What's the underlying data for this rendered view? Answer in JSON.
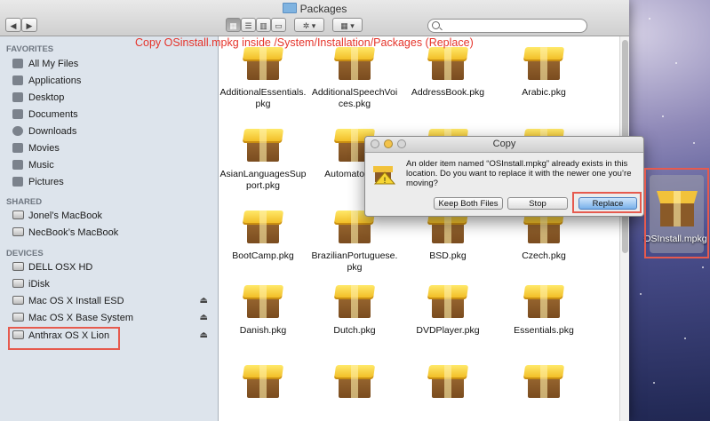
{
  "window": {
    "title": "Packages",
    "view_buttons": [
      "icon-view",
      "list-view",
      "column-view",
      "coverflow-view"
    ],
    "search_placeholder": ""
  },
  "annotation": "Copy OSinstall.mpkg inside /System/Installation/Packages (Replace)",
  "sidebar": {
    "favorites_header": "FAVORITES",
    "favorites": [
      {
        "label": "All My Files",
        "icon": "all-files-icon"
      },
      {
        "label": "Applications",
        "icon": "applications-icon"
      },
      {
        "label": "Desktop",
        "icon": "desktop-icon"
      },
      {
        "label": "Documents",
        "icon": "documents-icon"
      },
      {
        "label": "Downloads",
        "icon": "downloads-icon"
      },
      {
        "label": "Movies",
        "icon": "movies-icon"
      },
      {
        "label": "Music",
        "icon": "music-icon"
      },
      {
        "label": "Pictures",
        "icon": "pictures-icon"
      }
    ],
    "shared_header": "SHARED",
    "shared": [
      {
        "label": "Jonel’s MacBook"
      },
      {
        "label": "NecBook’s MacBook"
      }
    ],
    "devices_header": "DEVICES",
    "devices": [
      {
        "label": "DELL OSX HD",
        "eject": false
      },
      {
        "label": "iDisk",
        "eject": false
      },
      {
        "label": "Mac OS X Install ESD",
        "eject": true
      },
      {
        "label": "Mac OS X Base System",
        "eject": true
      },
      {
        "label": "Anthrax OS X Lion",
        "eject": true
      }
    ],
    "eject_glyph": "⏏"
  },
  "files": [
    {
      "name": "AdditionalEssentials.pkg"
    },
    {
      "name": "AdditionalSpeechVoices.pkg"
    },
    {
      "name": "AddressBook.pkg"
    },
    {
      "name": "Arabic.pkg"
    },
    {
      "name": "AsianLanguagesSupport.pkg"
    },
    {
      "name": "Automator.pkg"
    },
    {
      "name": ""
    },
    {
      "name": ""
    },
    {
      "name": "BootCamp.pkg"
    },
    {
      "name": "BrazilianPortuguese.pkg"
    },
    {
      "name": "BSD.pkg"
    },
    {
      "name": "Czech.pkg"
    },
    {
      "name": "Danish.pkg"
    },
    {
      "name": "Dutch.pkg"
    },
    {
      "name": "DVDPlayer.pkg"
    },
    {
      "name": "Essentials.pkg"
    },
    {
      "name": ""
    },
    {
      "name": ""
    },
    {
      "name": ""
    },
    {
      "name": ""
    }
  ],
  "dialog": {
    "title": "Copy",
    "message": "An older item named “OSInstall.mpkg” already exists in this location. Do you want to replace it with the newer one you’re moving?",
    "buttons": {
      "keep_both": "Keep Both Files",
      "stop": "Stop",
      "replace": "Replace"
    }
  },
  "dragged_item": {
    "name": "OSInstall.mpkg"
  },
  "colors": {
    "annotation": "#e5332a",
    "highlight": "#e65a4e",
    "sidebar_bg": "#dde4ec"
  }
}
